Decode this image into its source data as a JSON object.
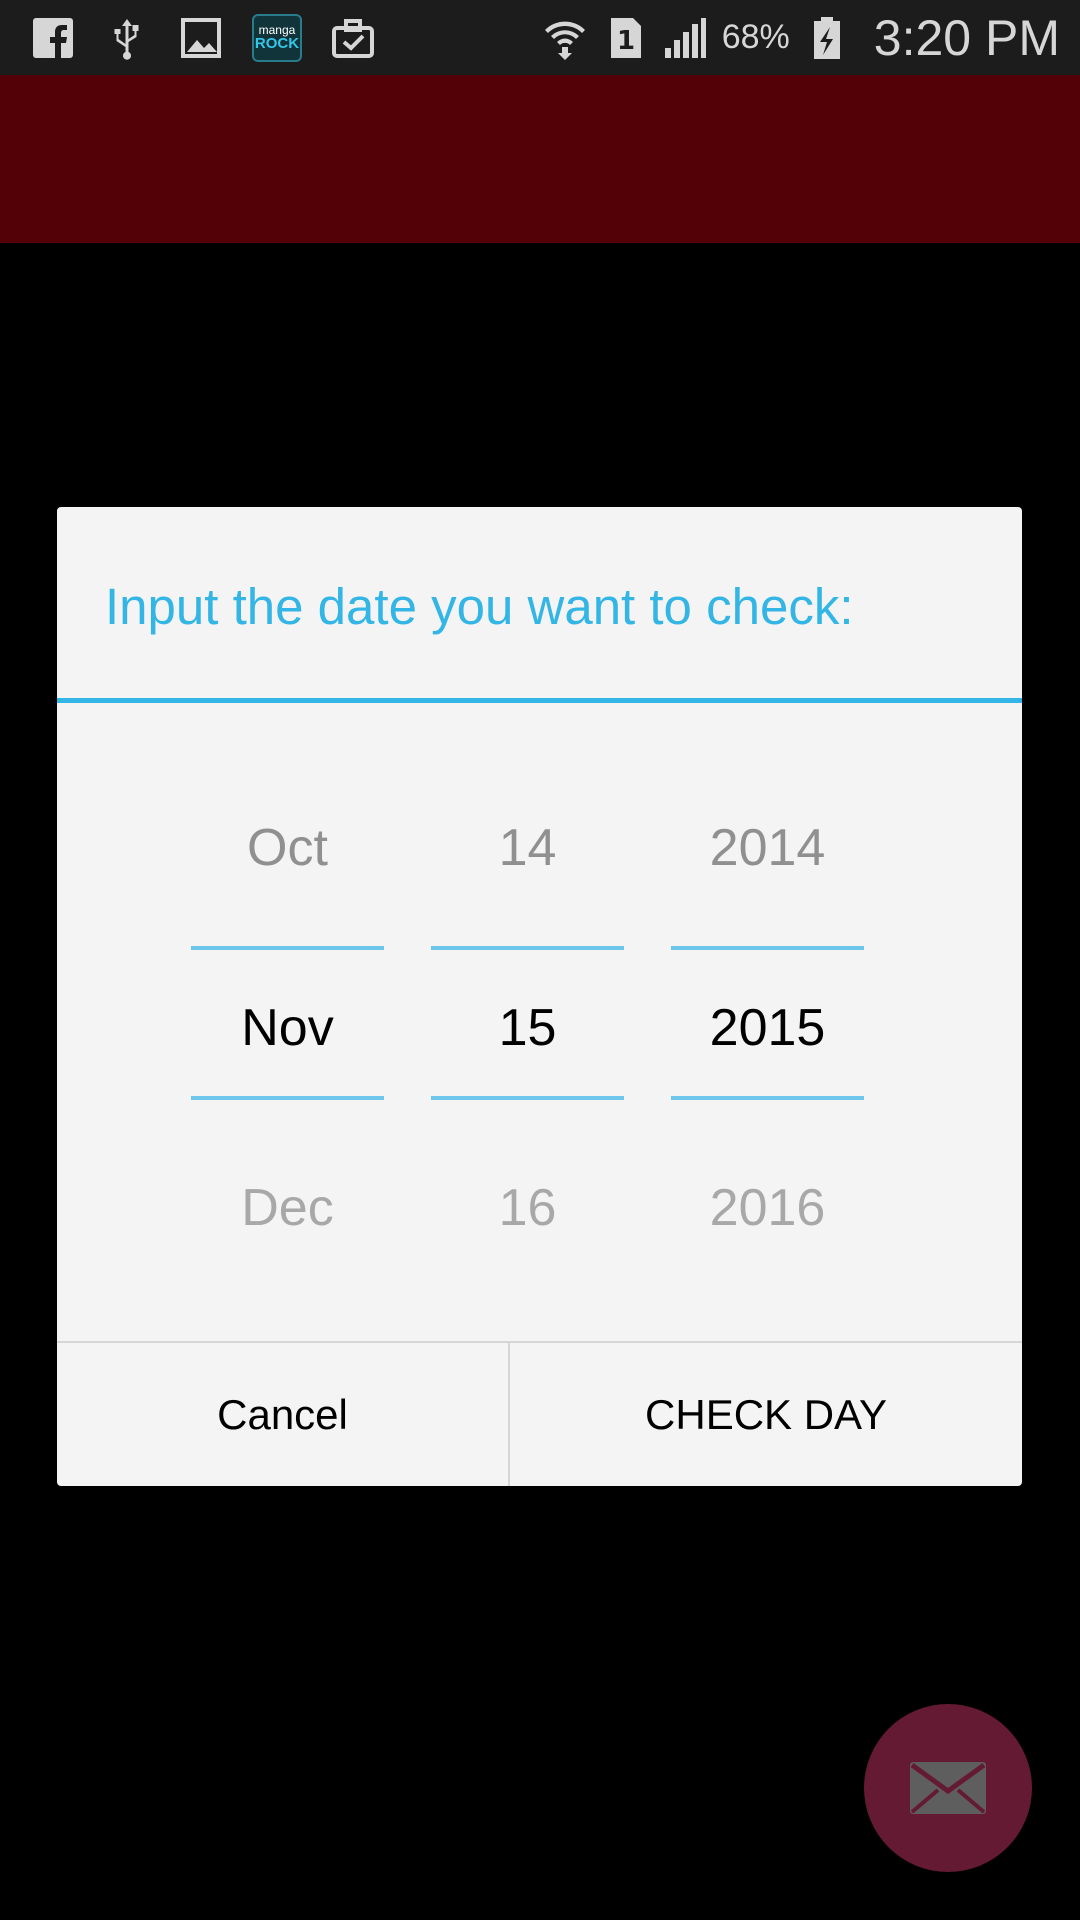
{
  "status_bar": {
    "left_icons": [
      "facebook-icon",
      "usb-icon",
      "gallery-icon",
      "manga-rock-icon",
      "briefcase-check-icon"
    ],
    "manga_icon_text": {
      "line1": "manga",
      "line2": "ROCK"
    },
    "right_icons": [
      "wifi-icon",
      "sim1-icon",
      "signal-icon",
      "battery-charging-icon"
    ],
    "sim_label": "1",
    "battery_percent": "68%",
    "time": "3:20 PM"
  },
  "app_bar": {
    "color": "#530006"
  },
  "dialog": {
    "title": "Input the date you want to check:",
    "accent_color": "#33b5e5",
    "picker": {
      "month": {
        "prev": "Oct",
        "current": "Nov",
        "next": "Dec"
      },
      "day": {
        "prev": "14",
        "current": "15",
        "next": "16"
      },
      "year": {
        "prev": "2014",
        "current": "2015",
        "next": "2016"
      }
    },
    "buttons": {
      "cancel": "Cancel",
      "confirm": "CHECK DAY"
    }
  },
  "fab": {
    "icon": "mail-icon",
    "color": "#641a33"
  }
}
